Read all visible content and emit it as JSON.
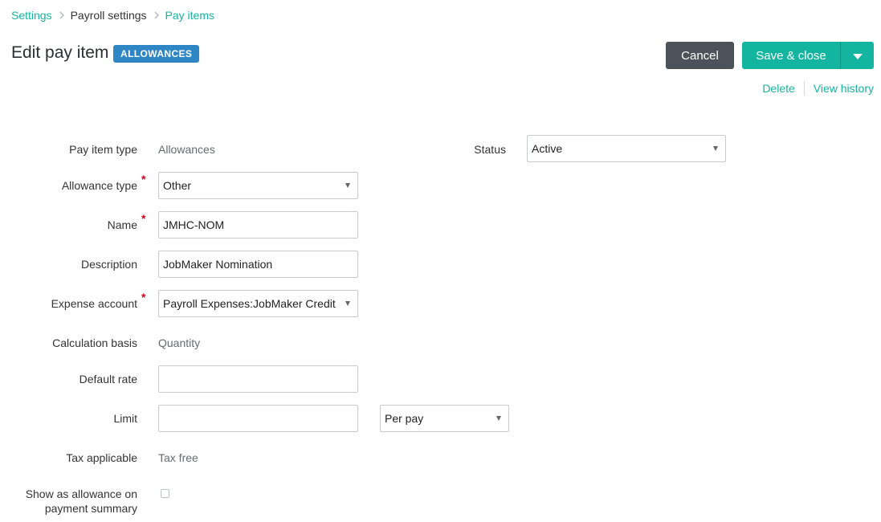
{
  "breadcrumb": {
    "items": [
      {
        "label": "Settings"
      },
      {
        "label": "Payroll settings"
      },
      {
        "label": "Pay items"
      }
    ]
  },
  "header": {
    "title": "Edit pay item",
    "badge": "ALLOWANCES"
  },
  "actions": {
    "cancel_label": "Cancel",
    "save_label": "Save & close",
    "split_icon": "caret-down-icon",
    "delete_label": "Delete",
    "view_history_label": "View history"
  },
  "form": {
    "pay_item_type": {
      "label": "Pay item type",
      "value": "Allowances"
    },
    "status": {
      "label": "Status",
      "value": "Active"
    },
    "allowance_type": {
      "label": "Allowance type",
      "value": "Other",
      "required": true
    },
    "name": {
      "label": "Name",
      "value": "JMHC-NOM",
      "required": true
    },
    "description": {
      "label": "Description",
      "value": "JobMaker Nomination"
    },
    "expense_account": {
      "label": "Expense account",
      "value": "Payroll Expenses:JobMaker Credit",
      "required": true
    },
    "calculation_basis": {
      "label": "Calculation basis",
      "value": "Quantity"
    },
    "default_rate": {
      "label": "Default rate",
      "value": ""
    },
    "limit": {
      "label": "Limit",
      "value": "",
      "period": "Per pay"
    },
    "tax_applicable": {
      "label": "Tax applicable",
      "value": "Tax free"
    },
    "show_allowance": {
      "label_line1": "Show as allowance on",
      "label_line2": "payment summary",
      "checked": false
    }
  },
  "colors": {
    "accent": "#13b5a0",
    "badge": "#2f86c4",
    "cancel": "#4b5259",
    "required": "#d0021b"
  }
}
